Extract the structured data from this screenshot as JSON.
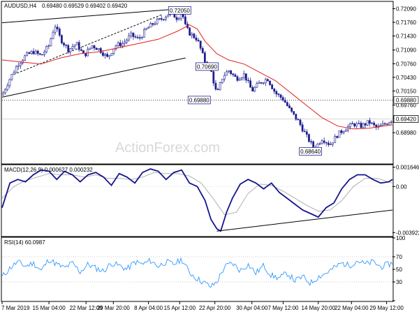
{
  "chart_data": [
    {
      "type": "candlestick",
      "panel": "price",
      "info": {
        "symbol_tf": "AUDUSD,H4",
        "ohlc": "0.69480 0.69529 0.69402 0.69420"
      },
      "watermark": "ActionForex.com",
      "ylim": [
        0.6835,
        0.7225
      ],
      "yticks": [
        {
          "value": 0.7209,
          "label": "0.72090"
        },
        {
          "value": 0.7176,
          "label": "0.71760"
        },
        {
          "value": 0.7143,
          "label": "0.71430"
        },
        {
          "value": 0.7109,
          "label": "0.71090"
        },
        {
          "value": 0.7076,
          "label": "0.70760"
        },
        {
          "value": 0.7043,
          "label": "0.70430"
        },
        {
          "value": 0.701,
          "label": "0.70150"
        },
        {
          "value": 0.6976,
          "label": "0.69760"
        },
        {
          "value": 0.6909,
          "label": "0.68980"
        }
      ],
      "levels": [
        {
          "value": 0.6988,
          "label": "0.69880",
          "style": "dotted"
        }
      ],
      "current_price": {
        "value": 0.6942,
        "label": "0.69420"
      },
      "annotations": [
        {
          "label": "0.72050",
          "t": 0.455,
          "value": 0.7205
        },
        {
          "label": "0.70690",
          "t": 0.525,
          "value": 0.7069
        },
        {
          "label": "0.69880",
          "t": 0.505,
          "value": 0.6988
        },
        {
          "label": "0.68640",
          "t": 0.79,
          "value": 0.6864
        }
      ],
      "close_path": [
        [
          0.0,
          0.7
        ],
        [
          0.02,
          0.704
        ],
        [
          0.04,
          0.7075
        ],
        [
          0.06,
          0.7095
        ],
        [
          0.08,
          0.7105
        ],
        [
          0.1,
          0.7095
        ],
        [
          0.12,
          0.712
        ],
        [
          0.135,
          0.717
        ],
        [
          0.15,
          0.7135
        ],
        [
          0.17,
          0.711
        ],
        [
          0.19,
          0.7125
        ],
        [
          0.21,
          0.7095
        ],
        [
          0.23,
          0.712
        ],
        [
          0.25,
          0.711
        ],
        [
          0.27,
          0.709
        ],
        [
          0.29,
          0.712
        ],
        [
          0.31,
          0.7125
        ],
        [
          0.33,
          0.7145
        ],
        [
          0.35,
          0.7135
        ],
        [
          0.37,
          0.716
        ],
        [
          0.39,
          0.7175
        ],
        [
          0.41,
          0.7185
        ],
        [
          0.43,
          0.72
        ],
        [
          0.45,
          0.7185
        ],
        [
          0.46,
          0.7205
        ],
        [
          0.47,
          0.7165
        ],
        [
          0.48,
          0.715
        ],
        [
          0.5,
          0.7135
        ],
        [
          0.52,
          0.708
        ],
        [
          0.535,
          0.706
        ],
        [
          0.55,
          0.7
        ],
        [
          0.565,
          0.7045
        ],
        [
          0.58,
          0.706
        ],
        [
          0.6,
          0.704
        ],
        [
          0.62,
          0.705
        ],
        [
          0.64,
          0.701
        ],
        [
          0.66,
          0.703
        ],
        [
          0.68,
          0.704
        ],
        [
          0.7,
          0.7005
        ],
        [
          0.72,
          0.699
        ],
        [
          0.74,
          0.696
        ],
        [
          0.76,
          0.6935
        ],
        [
          0.78,
          0.69
        ],
        [
          0.8,
          0.687
        ],
        [
          0.82,
          0.6895
        ],
        [
          0.84,
          0.688
        ],
        [
          0.86,
          0.6905
        ],
        [
          0.88,
          0.692
        ],
        [
          0.9,
          0.693
        ],
        [
          0.92,
          0.6925
        ],
        [
          0.94,
          0.6935
        ],
        [
          0.96,
          0.692
        ],
        [
          0.98,
          0.693
        ],
        [
          1.0,
          0.6942
        ]
      ],
      "ma_path": [
        [
          0.0,
          0.7085
        ],
        [
          0.05,
          0.708
        ],
        [
          0.1,
          0.7075
        ],
        [
          0.15,
          0.709
        ],
        [
          0.2,
          0.71
        ],
        [
          0.25,
          0.7105
        ],
        [
          0.3,
          0.7115
        ],
        [
          0.35,
          0.7125
        ],
        [
          0.4,
          0.7135
        ],
        [
          0.45,
          0.7155
        ],
        [
          0.48,
          0.717
        ],
        [
          0.5,
          0.716
        ],
        [
          0.52,
          0.713
        ],
        [
          0.55,
          0.71
        ],
        [
          0.58,
          0.7085
        ],
        [
          0.62,
          0.7075
        ],
        [
          0.66,
          0.7055
        ],
        [
          0.7,
          0.7035
        ],
        [
          0.74,
          0.7005
        ],
        [
          0.78,
          0.6975
        ],
        [
          0.82,
          0.6945
        ],
        [
          0.86,
          0.6925
        ],
        [
          0.9,
          0.6918
        ],
        [
          0.94,
          0.692
        ],
        [
          1.0,
          0.6928
        ]
      ],
      "trendlines": [
        {
          "from": [
            0.0,
            0.7175
          ],
          "to": [
            0.47,
            0.721
          ],
          "style": "solid"
        },
        {
          "from": [
            0.0,
            0.6995
          ],
          "to": [
            0.47,
            0.709
          ],
          "style": "solid"
        },
        {
          "from": [
            0.03,
            0.705
          ],
          "to": [
            0.41,
            0.7195
          ],
          "style": "dashed"
        }
      ]
    },
    {
      "type": "line",
      "panel": "macd",
      "label": "MACD(12,26,9) 0.000627 0.000232",
      "ylim": [
        -0.0042,
        0.0018
      ],
      "yticks": [
        {
          "value": 0.001646,
          "label": "0.001646"
        },
        {
          "value": 0.0,
          "label": "0.00"
        },
        {
          "value": -0.003922,
          "label": "-0.003922"
        }
      ],
      "macd_path": [
        [
          0.0,
          -0.0018
        ],
        [
          0.02,
          0.0003
        ],
        [
          0.04,
          0.0006
        ],
        [
          0.06,
          0.0004
        ],
        [
          0.08,
          0.001
        ],
        [
          0.1,
          0.0014
        ],
        [
          0.12,
          0.0013
        ],
        [
          0.14,
          0.0006
        ],
        [
          0.16,
          0.0013
        ],
        [
          0.18,
          0.001
        ],
        [
          0.2,
          0.0004
        ],
        [
          0.22,
          0.001
        ],
        [
          0.24,
          0.0012
        ],
        [
          0.26,
          0.0008
        ],
        [
          0.28,
          0.0001
        ],
        [
          0.3,
          0.0011
        ],
        [
          0.32,
          0.0008
        ],
        [
          0.34,
          0.0003
        ],
        [
          0.36,
          0.0012
        ],
        [
          0.38,
          0.0015
        ],
        [
          0.4,
          0.0013
        ],
        [
          0.42,
          0.0006
        ],
        [
          0.44,
          0.0012
        ],
        [
          0.46,
          0.0014
        ],
        [
          0.48,
          0.0003
        ],
        [
          0.5,
          0.0
        ],
        [
          0.52,
          -0.0012
        ],
        [
          0.535,
          -0.0028
        ],
        [
          0.55,
          -0.0036
        ],
        [
          0.56,
          -0.0038
        ],
        [
          0.575,
          -0.0022
        ],
        [
          0.59,
          -0.001
        ],
        [
          0.61,
          0.0002
        ],
        [
          0.63,
          0.0006
        ],
        [
          0.65,
          0.0003
        ],
        [
          0.67,
          -0.0002
        ],
        [
          0.69,
          0.0003
        ],
        [
          0.71,
          -0.0005
        ],
        [
          0.73,
          -0.001
        ],
        [
          0.75,
          -0.0015
        ],
        [
          0.77,
          -0.002
        ],
        [
          0.79,
          -0.0023
        ],
        [
          0.81,
          -0.0026
        ],
        [
          0.83,
          -0.0018
        ],
        [
          0.85,
          -0.0014
        ],
        [
          0.87,
          -0.0002
        ],
        [
          0.89,
          0.0006
        ],
        [
          0.91,
          0.001
        ],
        [
          0.93,
          0.001
        ],
        [
          0.95,
          0.0006
        ],
        [
          0.97,
          0.0003
        ],
        [
          0.99,
          0.0004
        ],
        [
          1.0,
          0.0006
        ]
      ],
      "signal_path": [
        [
          0.0,
          -0.001
        ],
        [
          0.03,
          0.0
        ],
        [
          0.06,
          0.0005
        ],
        [
          0.09,
          0.0008
        ],
        [
          0.12,
          0.0011
        ],
        [
          0.15,
          0.001
        ],
        [
          0.18,
          0.001
        ],
        [
          0.21,
          0.0008
        ],
        [
          0.24,
          0.001
        ],
        [
          0.27,
          0.0007
        ],
        [
          0.3,
          0.0007
        ],
        [
          0.33,
          0.0006
        ],
        [
          0.36,
          0.0008
        ],
        [
          0.39,
          0.0012
        ],
        [
          0.42,
          0.0011
        ],
        [
          0.45,
          0.0011
        ],
        [
          0.48,
          0.0009
        ],
        [
          0.51,
          0.0003
        ],
        [
          0.54,
          -0.001
        ],
        [
          0.57,
          -0.0024
        ],
        [
          0.6,
          -0.0022
        ],
        [
          0.63,
          -0.0006
        ],
        [
          0.66,
          0.0002
        ],
        [
          0.69,
          0.0001
        ],
        [
          0.72,
          -0.0004
        ],
        [
          0.75,
          -0.001
        ],
        [
          0.78,
          -0.0016
        ],
        [
          0.81,
          -0.0021
        ],
        [
          0.84,
          -0.002
        ],
        [
          0.87,
          -0.0012
        ],
        [
          0.9,
          0.0
        ],
        [
          0.93,
          0.0007
        ],
        [
          0.96,
          0.0007
        ],
        [
          1.0,
          0.0003
        ]
      ],
      "trendline": {
        "from": [
          0.55,
          -0.0038
        ],
        "to": [
          1.0,
          -0.002
        ]
      }
    },
    {
      "type": "line",
      "panel": "rsi",
      "label": "RSI(14) 60.0987",
      "ylim": [
        0,
        100
      ],
      "yticks": [
        {
          "value": 100,
          "label": "100"
        },
        {
          "value": 70,
          "label": "70"
        },
        {
          "value": 50,
          "label": "50"
        },
        {
          "value": 30,
          "label": "30"
        },
        {
          "value": 0,
          "label": "0"
        }
      ],
      "levels": [
        70,
        30
      ],
      "rsi_path": [
        [
          0.0,
          38
        ],
        [
          0.02,
          52
        ],
        [
          0.04,
          62
        ],
        [
          0.06,
          55
        ],
        [
          0.08,
          60
        ],
        [
          0.1,
          48
        ],
        [
          0.12,
          66
        ],
        [
          0.14,
          58
        ],
        [
          0.16,
          52
        ],
        [
          0.18,
          60
        ],
        [
          0.2,
          46
        ],
        [
          0.22,
          58
        ],
        [
          0.24,
          52
        ],
        [
          0.26,
          47
        ],
        [
          0.28,
          60
        ],
        [
          0.3,
          56
        ],
        [
          0.32,
          50
        ],
        [
          0.34,
          62
        ],
        [
          0.36,
          58
        ],
        [
          0.38,
          64
        ],
        [
          0.4,
          55
        ],
        [
          0.42,
          62
        ],
        [
          0.44,
          58
        ],
        [
          0.46,
          66
        ],
        [
          0.48,
          45
        ],
        [
          0.5,
          35
        ],
        [
          0.52,
          28
        ],
        [
          0.535,
          22
        ],
        [
          0.55,
          30
        ],
        [
          0.57,
          54
        ],
        [
          0.59,
          60
        ],
        [
          0.61,
          48
        ],
        [
          0.63,
          58
        ],
        [
          0.65,
          44
        ],
        [
          0.67,
          56
        ],
        [
          0.69,
          40
        ],
        [
          0.71,
          36
        ],
        [
          0.73,
          44
        ],
        [
          0.75,
          32
        ],
        [
          0.77,
          38
        ],
        [
          0.79,
          28
        ],
        [
          0.81,
          38
        ],
        [
          0.83,
          44
        ],
        [
          0.85,
          52
        ],
        [
          0.87,
          60
        ],
        [
          0.89,
          56
        ],
        [
          0.91,
          64
        ],
        [
          0.93,
          58
        ],
        [
          0.95,
          62
        ],
        [
          0.97,
          54
        ],
        [
          1.0,
          60
        ]
      ]
    }
  ],
  "x_axis": {
    "ticks": [
      {
        "t": 0.0,
        "label": "7 Mar 2019"
      },
      {
        "t": 0.12,
        "label": "15 Mar 04:00"
      },
      {
        "t": 0.215,
        "label": "22 Mar 12:00"
      },
      {
        "t": 0.285,
        "label": "29 Mar 20:00"
      },
      {
        "t": 0.375,
        "label": "8 Apr 04:00"
      },
      {
        "t": 0.455,
        "label": "15 Apr 12:00"
      },
      {
        "t": 0.545,
        "label": "22 Apr 20:00"
      },
      {
        "t": 0.64,
        "label": "30 Apr 04:00"
      },
      {
        "t": 0.72,
        "label": "7 May 12:00"
      },
      {
        "t": 0.81,
        "label": "14 May 20:00"
      },
      {
        "t": 0.895,
        "label": "22 May 04:00"
      },
      {
        "t": 0.985,
        "label": "29 May 12:00"
      }
    ]
  },
  "colors": {
    "candle_up": "#ffffff",
    "candle_down": "#1f1f8f",
    "ma": "#e02020",
    "macd": "#14148c",
    "signal": "#b0b0b0",
    "rsi": "#3399ff",
    "trendline": "#000000",
    "annotation_bg": "#ffffff",
    "annotation_border": "#1f1f8f",
    "watermark": "#d8d8d8"
  }
}
